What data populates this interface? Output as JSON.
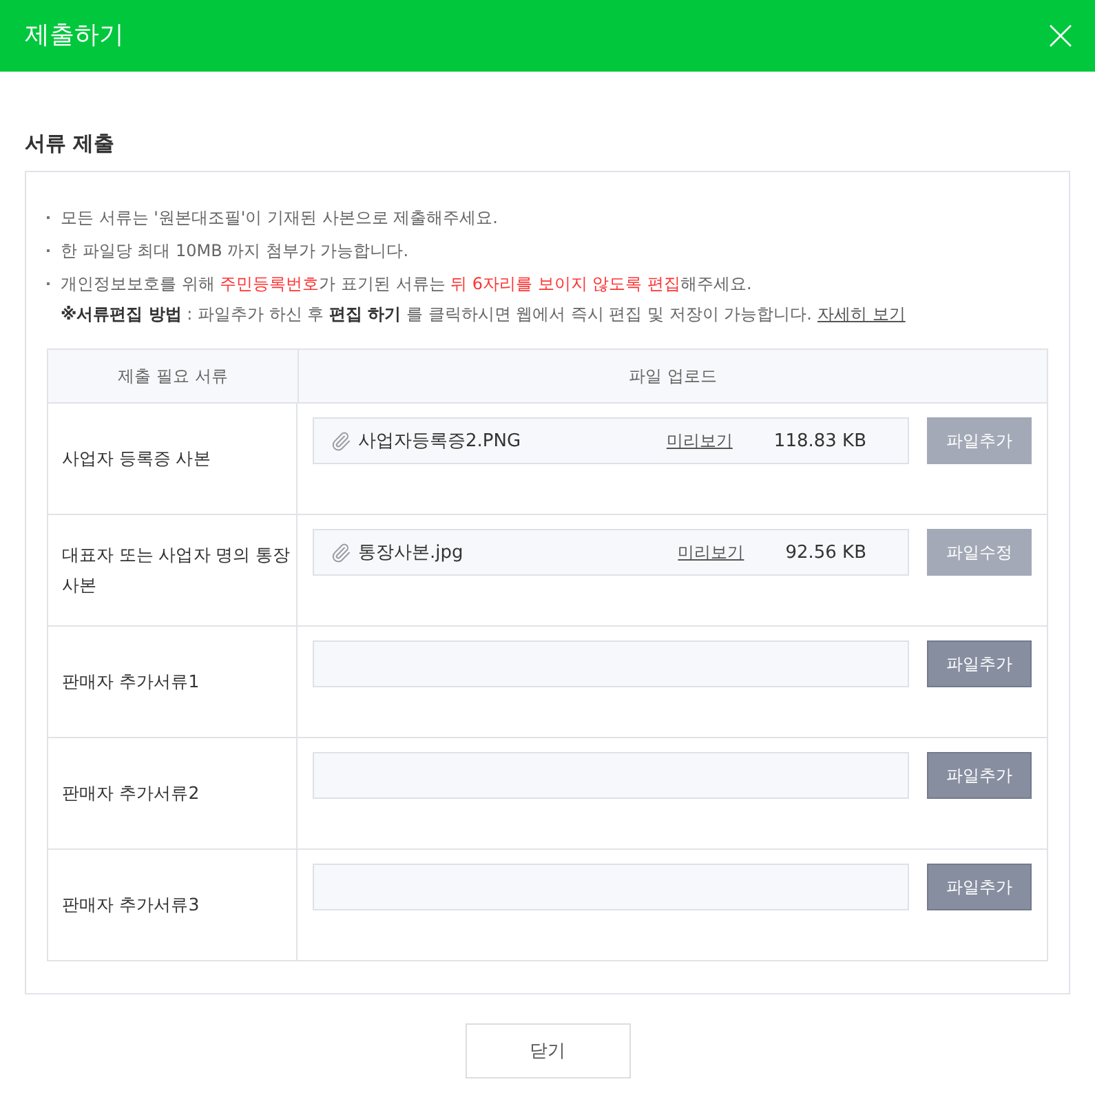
{
  "dialog": {
    "title": "제출하기"
  },
  "section": {
    "title": "서류 제출"
  },
  "notes": [
    {
      "segments": [
        {
          "text": "모든 서류는 '원본대조필'이 기재된 사본으로 제출해주세요.",
          "highlight": false
        }
      ]
    },
    {
      "segments": [
        {
          "text": "한 파일당 최대 10MB 까지 첨부가 가능합니다.",
          "highlight": false
        }
      ]
    },
    {
      "segments": [
        {
          "text": "개인정보보호를 위해 ",
          "highlight": false
        },
        {
          "text": "주민등록번호",
          "highlight": true
        },
        {
          "text": "가 표기된 서류는 ",
          "highlight": false
        },
        {
          "text": "뒤 6자리를 보이지 않도록 편집",
          "highlight": true
        },
        {
          "text": "해주세요.",
          "highlight": false
        }
      ]
    }
  ],
  "editing_guide": {
    "text": "**※서류편집 방법** : 파일추가 하신 후 **편집 하기** 를 클릭하시면 웹에서 즉시 편집 및 저장이 가능합니다.",
    "link": "자세히 보기"
  },
  "table": {
    "columns": [
      "제출 필요 서류",
      "파일 업로드"
    ],
    "rows": [
      {
        "label": "사업자 등록증 사본",
        "file": {
          "name": "사업자등록증2.PNG",
          "preview": "미리보기",
          "size": "118.83 KB"
        },
        "button": {
          "label": "파일추가",
          "disabled": true
        }
      },
      {
        "label": "대표자 또는 사업자 명의 통장 사본",
        "file": {
          "name": "통장사본.jpg",
          "preview": "미리보기",
          "size": "92.56 KB"
        },
        "button": {
          "label": "파일수정",
          "disabled": true
        }
      },
      {
        "label": "판매자 추가서류1",
        "button": {
          "label": "파일추가",
          "disabled": false
        }
      },
      {
        "label": "판매자 추가서류2",
        "button": {
          "label": "파일추가",
          "disabled": false
        }
      },
      {
        "label": "판매자 추가서류3",
        "button": {
          "label": "파일추가",
          "disabled": false
        }
      }
    ]
  },
  "footer": {
    "close_button": "닫기"
  }
}
